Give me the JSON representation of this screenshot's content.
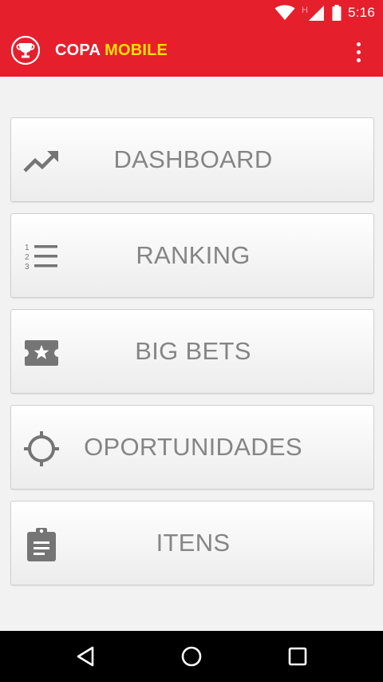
{
  "status_bar": {
    "time": "5:16",
    "icons": [
      "wifi-icon",
      "signal-icon",
      "battery-icon"
    ],
    "network_letter": "H"
  },
  "app_bar": {
    "title_part1": "COPA",
    "title_part2": "MOBILE",
    "logo_icon": "trophy-icon",
    "menu_icon": "more-vert-icon"
  },
  "menu": {
    "items": [
      {
        "label": "DASHBOARD",
        "icon": "trending-up-icon"
      },
      {
        "label": "RANKING",
        "icon": "numbered-list-icon"
      },
      {
        "label": "BIG BETS",
        "icon": "ticket-star-icon"
      },
      {
        "label": "OPORTUNIDADES",
        "icon": "crosshair-icon"
      },
      {
        "label": "ITENS",
        "icon": "clipboard-icon"
      }
    ]
  },
  "nav_bar": {
    "buttons": [
      "back-icon",
      "home-icon",
      "recents-icon"
    ]
  },
  "colors": {
    "primary": "#e61f2d",
    "accent": "#ffe000",
    "card_text": "#858585",
    "icon": "#757575"
  }
}
